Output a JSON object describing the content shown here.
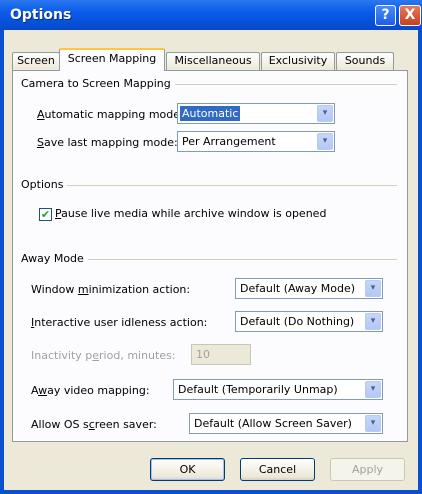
{
  "window": {
    "title": "Options",
    "help_label": "?",
    "close_label": "X"
  },
  "tabs": [
    {
      "label": "Screen"
    },
    {
      "label": "Screen Mapping"
    },
    {
      "label": "Miscellaneous"
    },
    {
      "label": "Exclusivity"
    },
    {
      "label": "Sounds"
    }
  ],
  "camera_mapping": {
    "group_label": "Camera to Screen Mapping",
    "auto_mode_label_ul": "A",
    "auto_mode_label_rest": "utomatic mapping mode:",
    "auto_mode_value": "Automatic",
    "save_mode_label_ul": "S",
    "save_mode_label_rest": "ave last mapping mode:",
    "save_mode_value": "Per Arrangement"
  },
  "options": {
    "group_label": "Options",
    "pause_label_ul": "P",
    "pause_label_rest": "ause live media while archive window is opened",
    "pause_checked": true,
    "check_glyph": "✔"
  },
  "away_mode": {
    "group_label": "Away Mode",
    "minimize_label_pre": "Window ",
    "minimize_label_ul": "m",
    "minimize_label_rest": "inimization action:",
    "minimize_value": "Default (Away Mode)",
    "idle_label_ul": "I",
    "idle_label_rest": "nteractive user idleness action:",
    "idle_value": "Default (Do Nothing)",
    "inactivity_label_pre": "Inactivity p",
    "inactivity_label_ul": "e",
    "inactivity_label_rest": "riod, minutes:",
    "inactivity_value": "10",
    "video_label_pre": "A",
    "video_label_ul": "w",
    "video_label_rest": "ay video mapping:",
    "video_value": "Default (Temporarily Unmap)",
    "saver_label_pre": "Allow OS s",
    "saver_label_ul": "c",
    "saver_label_rest": "reen saver:",
    "saver_value": "Default (Allow Screen Saver)"
  },
  "buttons": {
    "ok": "OK",
    "cancel": "Cancel",
    "apply": "Apply"
  },
  "icons": {
    "dropdown": "▾"
  },
  "colors": {
    "titlebar": "#0a5ce8",
    "selection": "#316ac5",
    "tab_highlight": "#ffc83c",
    "check": "#21a121"
  }
}
